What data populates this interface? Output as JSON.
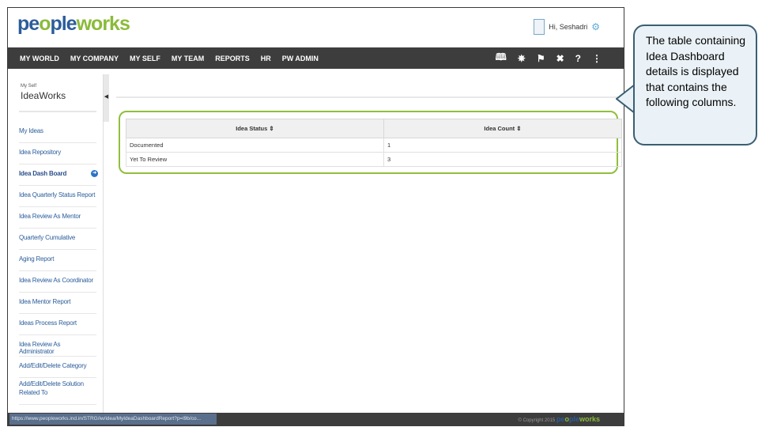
{
  "header": {
    "logo_pre": "pe",
    "logo_mid": "o",
    "logo_post": "ple",
    "logo_w": "w",
    "logo_o": "o",
    "logo_end": "rks",
    "greeting": "Hi, Seshadri"
  },
  "nav": {
    "items": [
      "MY WORLD",
      "MY COMPANY",
      "MY SELF",
      "MY TEAM",
      "REPORTS",
      "HR",
      "PW ADMIN"
    ],
    "icons": [
      "book-icon",
      "bulb-icon",
      "flag-icon",
      "tools-icon",
      "help-icon",
      "sitemap-icon"
    ]
  },
  "sidebar": {
    "subtitle": "My Self",
    "title": "IdeaWorks",
    "items": [
      "My Ideas",
      "Idea Repository",
      "Idea Dash Board",
      "Idea Quarterly Status Report",
      "Idea Review As Mentor",
      "Quarterly Cumulative",
      "Aging Report",
      "Idea Review As Coordinator",
      "Idea Mentor Report",
      "Ideas Process Report",
      "Idea Review As Administrator",
      "Add/Edit/Delete Category",
      "Add/Edit/Delete Solution Related To"
    ],
    "active_index": 2
  },
  "table": {
    "headers": [
      "Idea Status",
      "Idea Count"
    ],
    "rows": [
      [
        "Documented",
        "1"
      ],
      [
        "Yet To Review",
        "3"
      ]
    ]
  },
  "statusbar": {
    "url": "https://www.peopleworks.ind.in/STRG/iw/idea/MyIdeaDashboardReport?p=l9b/co...",
    "copyright": "© Copyright 2015"
  },
  "callout": {
    "text": "The table containing Idea Dashboard details is displayed that contains the following columns."
  },
  "colors": {
    "nav_bg": "#3d3d3d",
    "highlight": "#8fbf3c",
    "link": "#2b5d9b",
    "callout_bg": "#eaf2f7",
    "callout_border": "#3a5f73"
  }
}
